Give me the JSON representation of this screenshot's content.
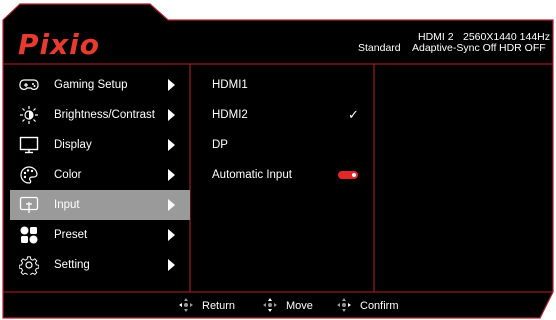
{
  "brand": "Pixio",
  "status": {
    "mode": "Standard",
    "input": "HDMI 2",
    "resolution_refresh": "2560X1440 144Hz",
    "adaptive_sync": "Adaptive-Sync Off",
    "hdr": "HDR OFF"
  },
  "menu": {
    "items": [
      {
        "label": "Gaming Setup",
        "icon": "gamepad-icon"
      },
      {
        "label": "Brightness/Contrast",
        "icon": "sun-icon"
      },
      {
        "label": "Display",
        "icon": "monitor-icon"
      },
      {
        "label": "Color",
        "icon": "palette-icon"
      },
      {
        "label": "Input",
        "icon": "input-icon",
        "active": true
      },
      {
        "label": "Preset",
        "icon": "preset-icon"
      },
      {
        "label": "Setting",
        "icon": "gear-icon"
      }
    ]
  },
  "submenu": {
    "items": [
      {
        "label": "HDMI1"
      },
      {
        "label": "HDMI2",
        "selected": true
      },
      {
        "label": "DP"
      },
      {
        "label": "Automatic Input",
        "toggle_on": true
      }
    ]
  },
  "footer": {
    "return_label": "Return",
    "move_label": "Move",
    "confirm_label": "Confirm"
  },
  "colors": {
    "background": "#000000",
    "border": "#b3202a",
    "brand": "#e83a2e",
    "highlight": "#9a9a9a",
    "toggle": "#e0282b"
  }
}
